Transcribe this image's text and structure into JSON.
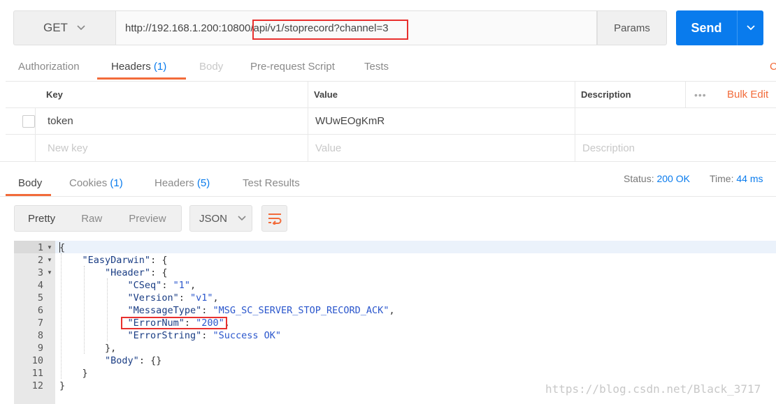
{
  "request": {
    "method": "GET",
    "url": "http://192.168.1.200:10800/api/v1/stoprecord?channel=3",
    "params_label": "Params",
    "send_label": "Send"
  },
  "request_tabs": [
    {
      "label": "Authorization",
      "count": ""
    },
    {
      "label": "Headers",
      "count": "(1)"
    },
    {
      "label": "Body",
      "count": ""
    },
    {
      "label": "Pre-request Script",
      "count": ""
    },
    {
      "label": "Tests",
      "count": ""
    }
  ],
  "cookies_link": "C",
  "headers_table": {
    "col_key": "Key",
    "col_value": "Value",
    "col_description": "Description",
    "dots": "•••",
    "bulk_edit": "Bulk Edit",
    "rows": [
      {
        "key": "token",
        "value": "WUwEOgKmR",
        "description": ""
      }
    ],
    "new_row": {
      "key": "New key",
      "value": "Value",
      "description": "Description"
    }
  },
  "response_tabs": [
    {
      "label": "Body",
      "count": ""
    },
    {
      "label": "Cookies",
      "count": "(1)"
    },
    {
      "label": "Headers",
      "count": "(5)"
    },
    {
      "label": "Test Results",
      "count": ""
    }
  ],
  "response_status": {
    "status_label": "Status:",
    "status_value": "200 OK",
    "time_label": "Time:",
    "time_value": "44 ms"
  },
  "view_modes": [
    "Pretty",
    "Raw",
    "Preview"
  ],
  "format": "JSON",
  "colors": {
    "accent": "#097bed",
    "highlight": "#f26b3a",
    "annotation": "#e8302e"
  },
  "code_lines": [
    {
      "n": "1",
      "fold": true,
      "text": "{"
    },
    {
      "n": "2",
      "fold": true,
      "text": "    \"EasyDarwin\": {"
    },
    {
      "n": "3",
      "fold": true,
      "text": "        \"Header\": {"
    },
    {
      "n": "4",
      "fold": false,
      "text": "            \"CSeq\": \"1\","
    },
    {
      "n": "5",
      "fold": false,
      "text": "            \"Version\": \"v1\","
    },
    {
      "n": "6",
      "fold": false,
      "text": "            \"MessageType\": \"MSG_SC_SERVER_STOP_RECORD_ACK\","
    },
    {
      "n": "7",
      "fold": false,
      "text": "            \"ErrorNum\": \"200\","
    },
    {
      "n": "8",
      "fold": false,
      "text": "            \"ErrorString\": \"Success OK\""
    },
    {
      "n": "9",
      "fold": false,
      "text": "        },"
    },
    {
      "n": "10",
      "fold": false,
      "text": "        \"Body\": {}"
    },
    {
      "n": "11",
      "fold": false,
      "text": "    }"
    },
    {
      "n": "12",
      "fold": false,
      "text": "}"
    }
  ],
  "watermark": "https://blog.csdn.net/Black_3717"
}
